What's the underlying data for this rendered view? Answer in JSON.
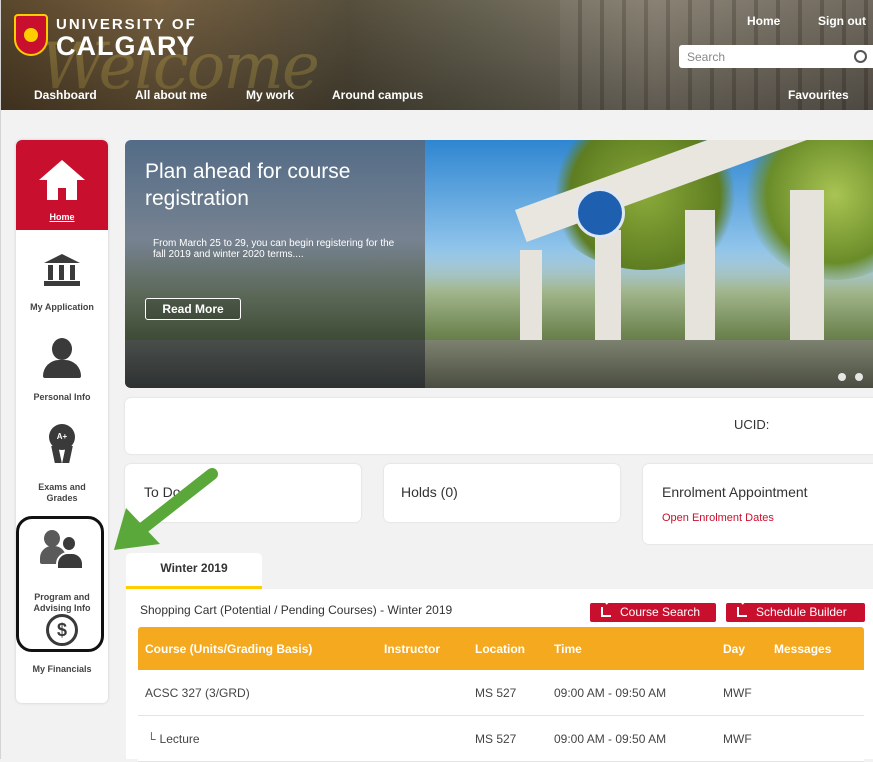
{
  "header": {
    "brand_line1": "UNIVERSITY OF",
    "brand_line2": "CALGARY",
    "nav": [
      {
        "label": "Dashboard"
      },
      {
        "label": "All about me"
      },
      {
        "label": "My work"
      },
      {
        "label": "Around campus"
      }
    ],
    "home_link": "Home",
    "signout_link": "Sign out",
    "search_placeholder": "Search",
    "favourites_label": "Favourites"
  },
  "sidebar": {
    "items": [
      {
        "label": "Home",
        "icon": "home-icon",
        "active": true
      },
      {
        "label": "My Application",
        "icon": "bank-icon"
      },
      {
        "label": "Personal Info",
        "icon": "person-icon"
      },
      {
        "label": "Exams and Grades",
        "icon": "award-icon"
      },
      {
        "label": "Program and Advising Info",
        "icon": "advisors-icon",
        "highlighted": true
      },
      {
        "label": "My Financials",
        "icon": "dollar-icon"
      }
    ],
    "award_badge_text": "A+",
    "dollar_glyph": "$"
  },
  "hero": {
    "title": "Plan ahead for course registration",
    "text": "From March 25 to 29, you can begin registering for the fall 2019 and winter 2020 terms....",
    "button_label": "Read More"
  },
  "ucid": {
    "label": "UCID:"
  },
  "cards": {
    "todo": "To Do",
    "holds": "Holds (0)",
    "enrolment_title": "Enrolment Appointment",
    "enrolment_link": "Open Enrolment Dates"
  },
  "term_tab": "Winter 2019",
  "cart": {
    "title": "Shopping Cart (Potential / Pending Courses) - Winter 2019",
    "course_search_btn": "Course Search",
    "schedule_builder_btn": "Schedule Builder",
    "columns": [
      "Course (Units/Grading Basis)",
      "Instructor",
      "Location",
      "Time",
      "Day",
      "Messages"
    ],
    "rows": [
      {
        "course": "ACSC 327 (3/GRD)",
        "instructor": "",
        "location": "MS 527",
        "time": "09:00 AM - 09:50 AM",
        "day": "MWF",
        "messages": ""
      },
      {
        "course": "Lecture",
        "instructor": "",
        "location": "MS 527",
        "time": "09:00 AM - 09:50 AM",
        "day": "MWF",
        "messages": ""
      }
    ]
  },
  "colors": {
    "brand_red": "#c8102e",
    "table_header": "#f4a91f",
    "tab_underline": "#ffcd00",
    "annotation_arrow": "#5aa83a"
  }
}
